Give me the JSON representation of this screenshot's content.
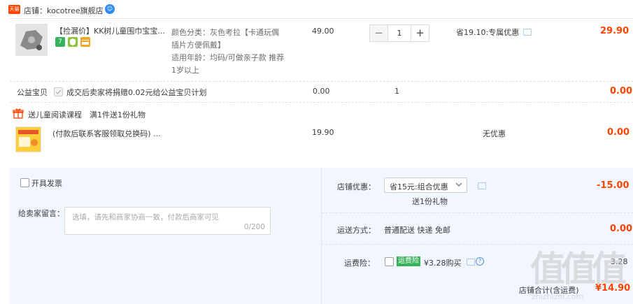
{
  "shop": {
    "badge": "天猫",
    "label": "店铺：kocotree旗舰店",
    "ww": "☺"
  },
  "item": {
    "title": "【捡漏价】KK树儿童围巾宝宝...",
    "attr_color_label": "颜色分类：",
    "attr_color_value": "灰色考拉【卡通玩偶",
    "attr_color_value2": "插片方便佩戴】",
    "attr_age_label": "适用年龄：",
    "attr_age_value": "均码/可做亲子款 推荐",
    "attr_age_value2": "1岁以上",
    "unit_price": "49.00",
    "qty": "1",
    "qty_minus": "−",
    "qty_plus": "+",
    "discount": "省19.10:专属优惠",
    "subtotal": "29.90",
    "icons": [
      "seven-day-return",
      "guarantee",
      "credit-card"
    ],
    "icon_seven": "7"
  },
  "charity": {
    "label": "公益宝贝",
    "text": "成交后卖家将捐赠0.02元给公益宝贝计划",
    "price": "0.00",
    "qty": "1",
    "subtotal": "0.00"
  },
  "gift_header": {
    "label": "送儿童阅读课程",
    "rule": "满1件送1份礼物"
  },
  "gift": {
    "title": "(付款后联系客服领取兑换码) ...",
    "price": "19.90",
    "discount": "无优惠",
    "subtotal": "0.00"
  },
  "invoice": {
    "label": "开具发票"
  },
  "message": {
    "label": "给卖家留言：",
    "placeholder": "选填，请先和商家协商一致，付款后商家可见",
    "counter": "0/200"
  },
  "promo": {
    "label": "店铺优惠：",
    "selected": "省15元:组合优惠",
    "gift_note": "送1份礼物",
    "amount": "-15.00"
  },
  "shipping": {
    "label": "运送方式：",
    "method": "普通配送 快递 免邮",
    "amount": "0.00"
  },
  "insurance": {
    "label": "运费险：",
    "tag": "运费险",
    "price": "¥3.28购买",
    "amount": "3.28"
  },
  "total": {
    "label": "店铺合计(含运费)",
    "amount": "¥14.90"
  },
  "watermark": {
    "text": "值值值",
    "sub": "zhizhizhi.com"
  },
  "colors": {
    "accent": "#ff4400",
    "link": "#3385ff",
    "bottom_bg": "#f2f7ff"
  }
}
